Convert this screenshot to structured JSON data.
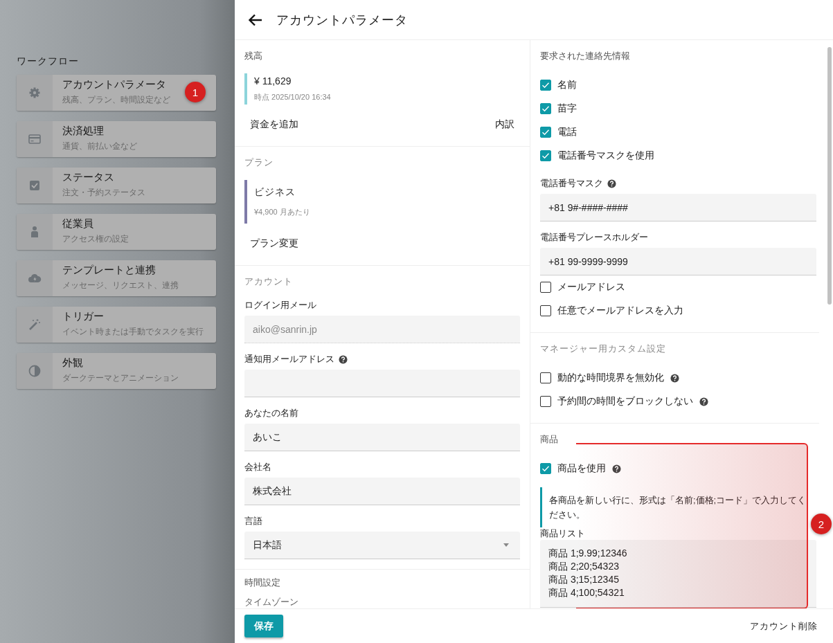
{
  "header": {
    "title": "アカウントパラメータ"
  },
  "sidebar": {
    "heading": "ワークフロー",
    "items": [
      {
        "kind": "gear",
        "title": "アカウントパラメータ",
        "subtitle": "残高、プラン、時間設定など"
      },
      {
        "kind": "card",
        "title": "決済処理",
        "subtitle": "通貨、前払い金など"
      },
      {
        "kind": "check",
        "title": "ステータス",
        "subtitle": "注文・予約ステータス"
      },
      {
        "kind": "person",
        "title": "従業員",
        "subtitle": "アクセス権の設定"
      },
      {
        "kind": "cloud",
        "title": "テンプレートと連携",
        "subtitle": "メッセージ、リクエスト、連携"
      },
      {
        "kind": "wand",
        "title": "トリガー",
        "subtitle": "イベント時または手動でタスクを実行"
      },
      {
        "kind": "contrast",
        "title": "外観",
        "subtitle": "ダークテーマとアニメーション"
      }
    ]
  },
  "balance": {
    "title": "残高",
    "amount": "¥ 11,629",
    "timestamp": "時点 2025/10/20 16:34",
    "color": "#8dd4db",
    "actions": [
      "資金を追加",
      "内訳"
    ]
  },
  "plan": {
    "title": "プラン",
    "name": "ビジネス",
    "price": "¥4,900 月あたり",
    "color": "#7e7aa8",
    "actions": [
      "プラン変更"
    ]
  },
  "account": {
    "title": "アカウント",
    "fields": [
      {
        "kind": "input",
        "label": "ログイン用メール",
        "value": "aiko@sanrin.jp",
        "disabled": true
      },
      {
        "kind": "input",
        "label": "通知用メールアドレス",
        "disabled": false,
        "help": true
      },
      {
        "kind": "input",
        "label": "あなたの名前",
        "value": "あいこ",
        "disabled": false
      },
      {
        "kind": "input",
        "label": "会社名",
        "value": "株式会社",
        "disabled": false
      },
      {
        "kind": "select",
        "label": "言語",
        "value": "日本語",
        "disabled": false
      }
    ]
  },
  "time_settings": {
    "title": "時間設定",
    "label": "タイムゾーン"
  },
  "contact": {
    "title": "要求された連絡先情報",
    "items": [
      {
        "kind": "checkbox",
        "label": "名前",
        "checked": true
      },
      {
        "kind": "checkbox",
        "label": "苗字",
        "checked": true
      },
      {
        "kind": "checkbox",
        "label": "電話",
        "checked": true
      },
      {
        "kind": "checkbox",
        "label": "電話番号マスクを使用",
        "checked": true
      },
      {
        "kind": "field",
        "label": "電話番号マスク",
        "value": "+81 9#-####-####",
        "help": true
      },
      {
        "kind": "field",
        "label": "電話番号プレースホルダー",
        "value": "+81 99-9999-9999"
      },
      {
        "kind": "checkbox",
        "label": "メールアドレス",
        "checked": false
      },
      {
        "kind": "checkbox",
        "label": "任意でメールアドレスを入力",
        "checked": false
      }
    ]
  },
  "manager": {
    "title": "マネージャー用カスタム設定",
    "items": [
      {
        "kind": "checkbox",
        "label": "動的な時間境界を無効化",
        "checked": false,
        "help": true
      },
      {
        "kind": "checkbox",
        "label": "予約間の時間をブロックしない",
        "checked": false,
        "help": true
      }
    ]
  },
  "products": {
    "title": "商品",
    "use": {
      "label": "商品を使用",
      "checked": true,
      "help": true
    },
    "note": "各商品を新しい行に、形式は「名前;価格;コード」で入力してください。",
    "list_label": "商品リスト",
    "lines": [
      "商品 1;9.99;12346",
      "商品 2;20;54323",
      "商品 3;15;12345",
      "商品 4;100;54321"
    ]
  },
  "footer": {
    "save": "保存",
    "delete": "アカウント削除"
  },
  "annotations": [
    {
      "label": "1"
    },
    {
      "label": "2"
    }
  ]
}
